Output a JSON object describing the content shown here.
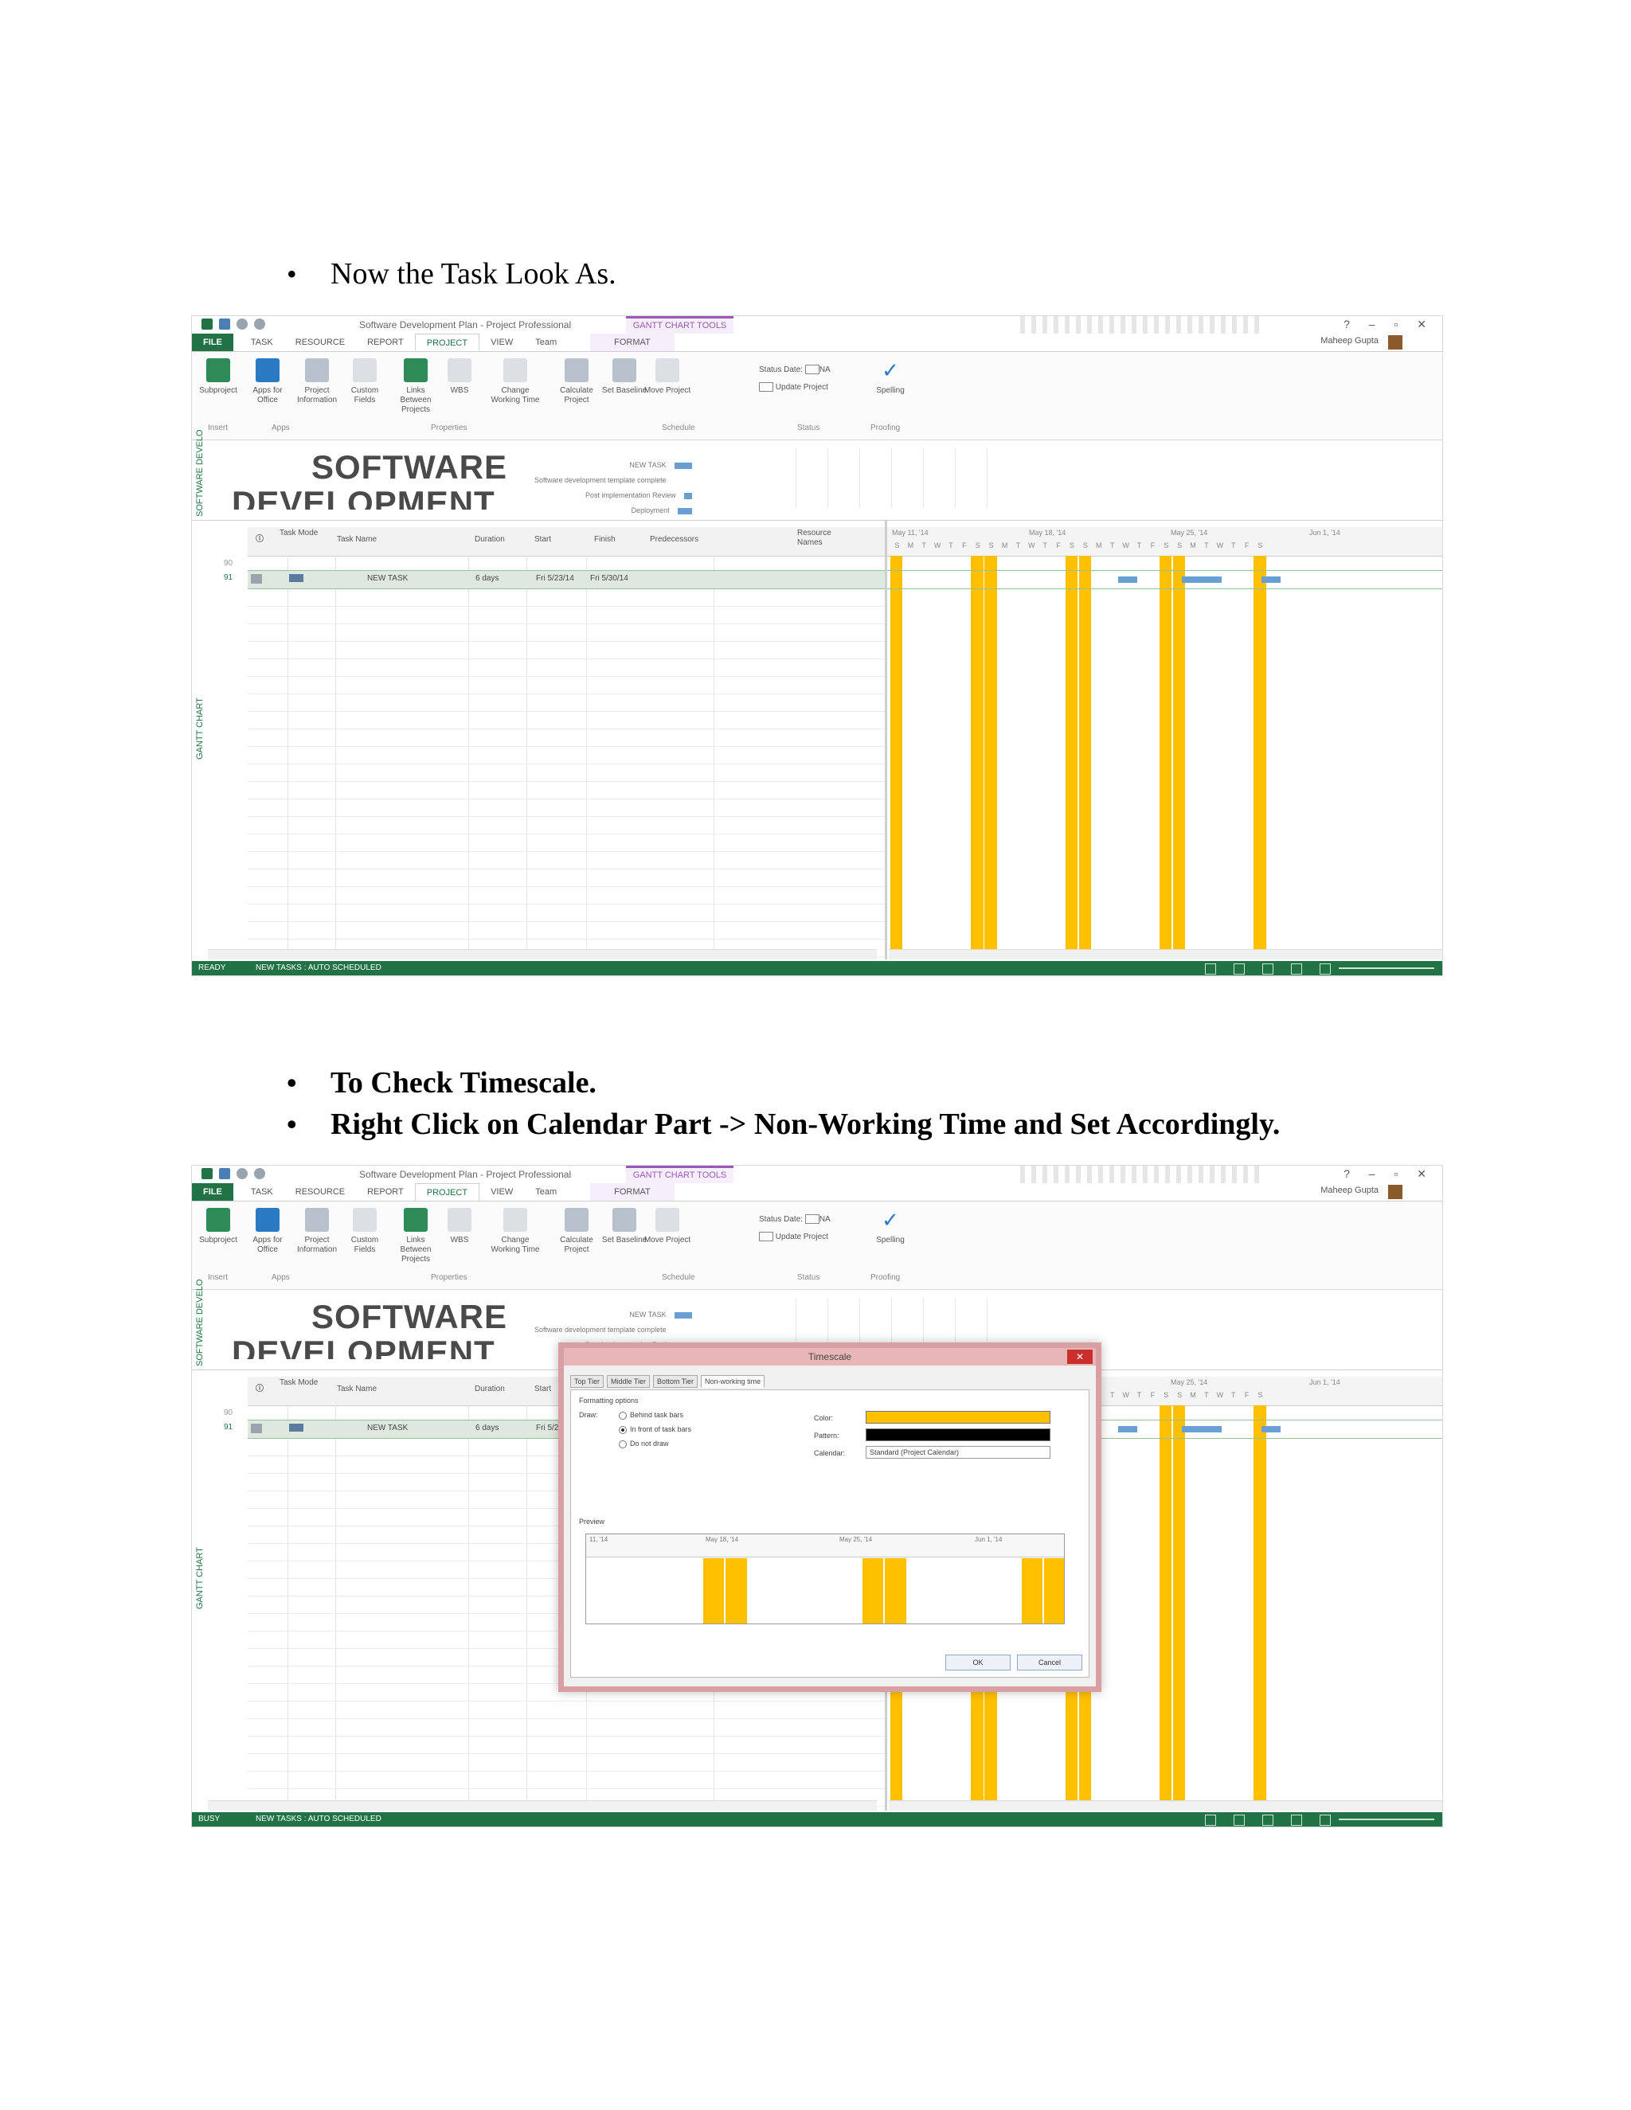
{
  "doc": {
    "bullet1": "Now the Task Look As.",
    "bullet2": "To Check Timescale.",
    "bullet3": "Right Click on Calendar Part -> Non-Working Time and Set Accordingly."
  },
  "app": {
    "title": "Software Development Plan - Project Professional",
    "context_tab": "GANTT CHART TOOLS",
    "user": "Maheep Gupta",
    "tabs": [
      "FILE",
      "TASK",
      "RESOURCE",
      "REPORT",
      "PROJECT",
      "VIEW",
      "Team",
      "FORMAT"
    ],
    "ribbon_buttons": [
      {
        "label": "Subproject",
        "icon": "subproject-icon"
      },
      {
        "label": "Apps for Office",
        "icon": "apps-icon"
      },
      {
        "label": "Project Information",
        "icon": "project-info-icon"
      },
      {
        "label": "Custom Fields",
        "icon": "custom-fields-icon"
      },
      {
        "label": "Links Between Projects",
        "icon": "links-icon"
      },
      {
        "label": "WBS",
        "icon": "wbs-icon"
      },
      {
        "label": "Change Working Time",
        "icon": "working-time-icon"
      },
      {
        "label": "Calculate Project",
        "icon": "calculate-icon"
      },
      {
        "label": "Set Baseline",
        "icon": "baseline-icon"
      },
      {
        "label": "Move Project",
        "icon": "move-icon"
      },
      {
        "label": "Spelling",
        "icon": "spelling-icon"
      }
    ],
    "status_date": "Status Date:",
    "status_date_value": "NA",
    "update_project": "Update Project",
    "groups": [
      "Insert",
      "Apps",
      "Properties",
      "Schedule",
      "Status",
      "Proofing"
    ],
    "timeline_title_1": "SOFTWARE",
    "timeline_title_2": "DEVELOPMENT",
    "timeline_items": [
      "NEW TASK",
      "Software development template complete",
      "Post implementation Review",
      "Deployment"
    ],
    "side_top": "SOFTWARE DEVELO",
    "side_bottom": "GANTT CHART",
    "columns": [
      "Task Mode",
      "Task Name",
      "Duration",
      "Start",
      "Finish",
      "Predecessors",
      "Resource Names"
    ],
    "row": {
      "id": "91",
      "name": "NEW TASK",
      "duration": "6 days",
      "start": "Fri 5/23/14",
      "finish": "Fri 5/30/14"
    },
    "prev_row_id": "90",
    "weeks": [
      "May 11, '14",
      "May 18, '14",
      "May 25, '14",
      "Jun 1, '14"
    ],
    "days": [
      "S",
      "M",
      "T",
      "W",
      "T",
      "F",
      "S",
      "S",
      "M",
      "T",
      "W",
      "T",
      "F",
      "S",
      "S",
      "M",
      "T",
      "W",
      "T",
      "F",
      "S",
      "S",
      "M",
      "T",
      "W",
      "T",
      "F",
      "S"
    ],
    "status_ready": "READY",
    "status_busy": "BUSY",
    "status_new_tasks": "NEW TASKS : AUTO SCHEDULED",
    "colors": {
      "accent": "#217346",
      "nonworking": "#ffc000",
      "taskbar": "#6a9fd4"
    }
  },
  "dialog": {
    "title": "Timescale",
    "tabs": [
      "Top Tier",
      "Middle Tier",
      "Bottom Tier",
      "Non-working time"
    ],
    "section": "Formatting options",
    "draw_label": "Draw:",
    "options": [
      "Behind task bars",
      "In front of task bars",
      "Do not draw"
    ],
    "selected_option": "In front of task bars",
    "color_label": "Color:",
    "pattern_label": "Pattern:",
    "calendar_label": "Calendar:",
    "calendar_value": "Standard (Project Calendar)",
    "preview_label": "Preview",
    "preview_weeks": [
      "11, '14",
      "May 18, '14",
      "May 25, '14",
      "Jun 1, '14"
    ],
    "ok": "OK",
    "cancel": "Cancel"
  }
}
